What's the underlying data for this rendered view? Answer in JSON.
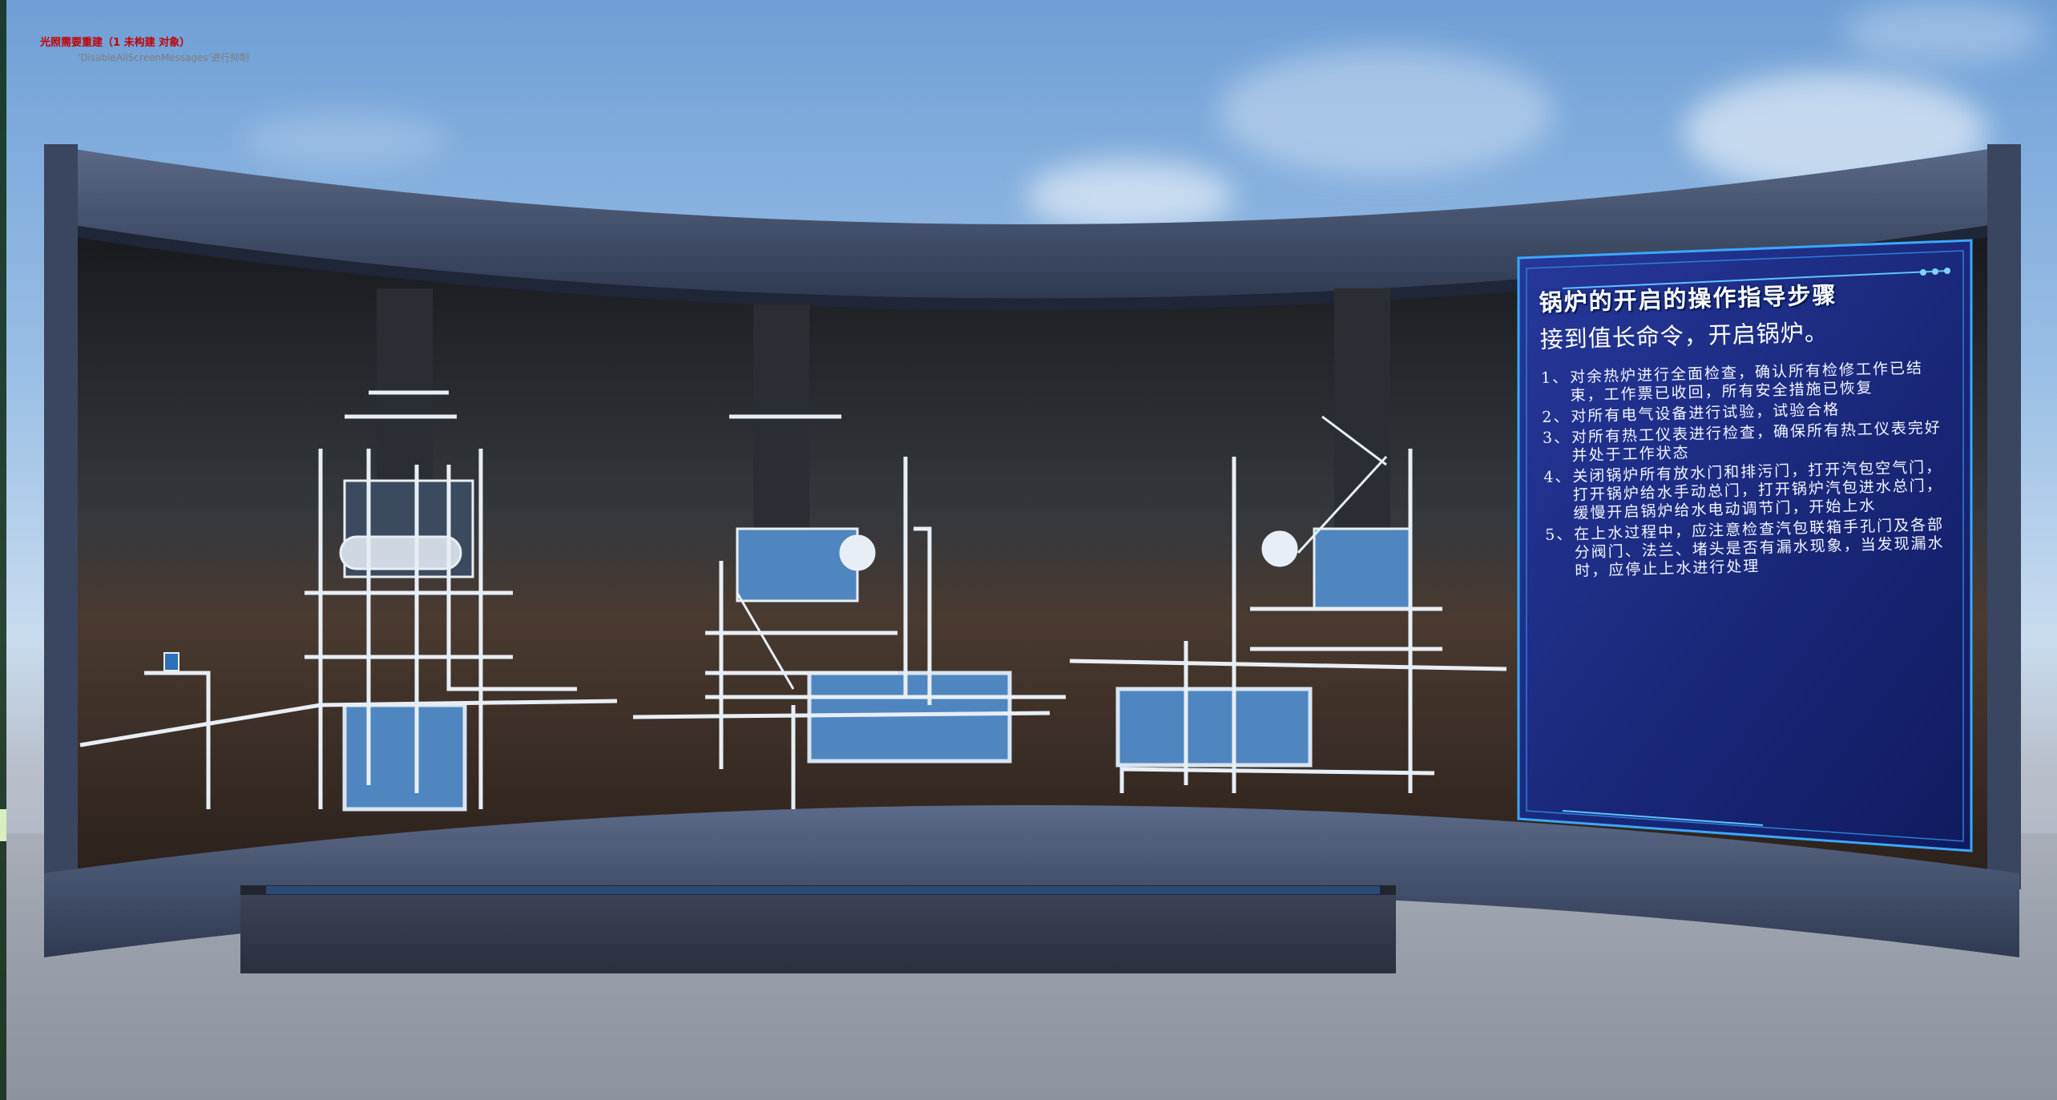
{
  "debug": {
    "warning": "光照需要重建（1 未构建 对象）",
    "hint": "'DisableAllScreenMessages'进行抑制"
  },
  "guide_panel": {
    "title": "锅炉的开启的操作指导步骤",
    "subtitle": "接到值长命令，开启锅炉。",
    "steps": [
      {
        "num": "1、",
        "text": "对余热炉进行全面检查，确认所有检修工作已结束，工作票已收回，所有安全措施已恢复"
      },
      {
        "num": "2、",
        "text": "对所有电气设备进行试验，试验合格"
      },
      {
        "num": "3、",
        "text": "对所有热工仪表进行检查，确保所有热工仪表完好并处于工作状态"
      },
      {
        "num": "4、",
        "text": "关闭锅炉所有放水门和排污门，打开汽包空气门，打开锅炉给水手动总门，打开锅炉汽包进水总门，缓慢开启锅炉给水电动调节门，开始上水"
      },
      {
        "num": "5、",
        "text": "在上水过程中，应注意检查汽包联箱手孔门及各部分阀门、法兰、堵头是否有漏水现象，当发现漏水时，应停止上水进行处理"
      }
    ]
  },
  "models": [
    {
      "name": "boiler-model-left"
    },
    {
      "name": "boiler-model-center"
    },
    {
      "name": "boiler-model-right"
    }
  ],
  "colors": {
    "frame": "#3d4a64",
    "screen_top": "#22262e",
    "screen_bottom": "#3a2e26",
    "equipment_blue": "#4f86c0",
    "pipe_white": "#e8eef5",
    "panel_blue": "#1f2f8a",
    "panel_glow": "#3aa8ff"
  }
}
